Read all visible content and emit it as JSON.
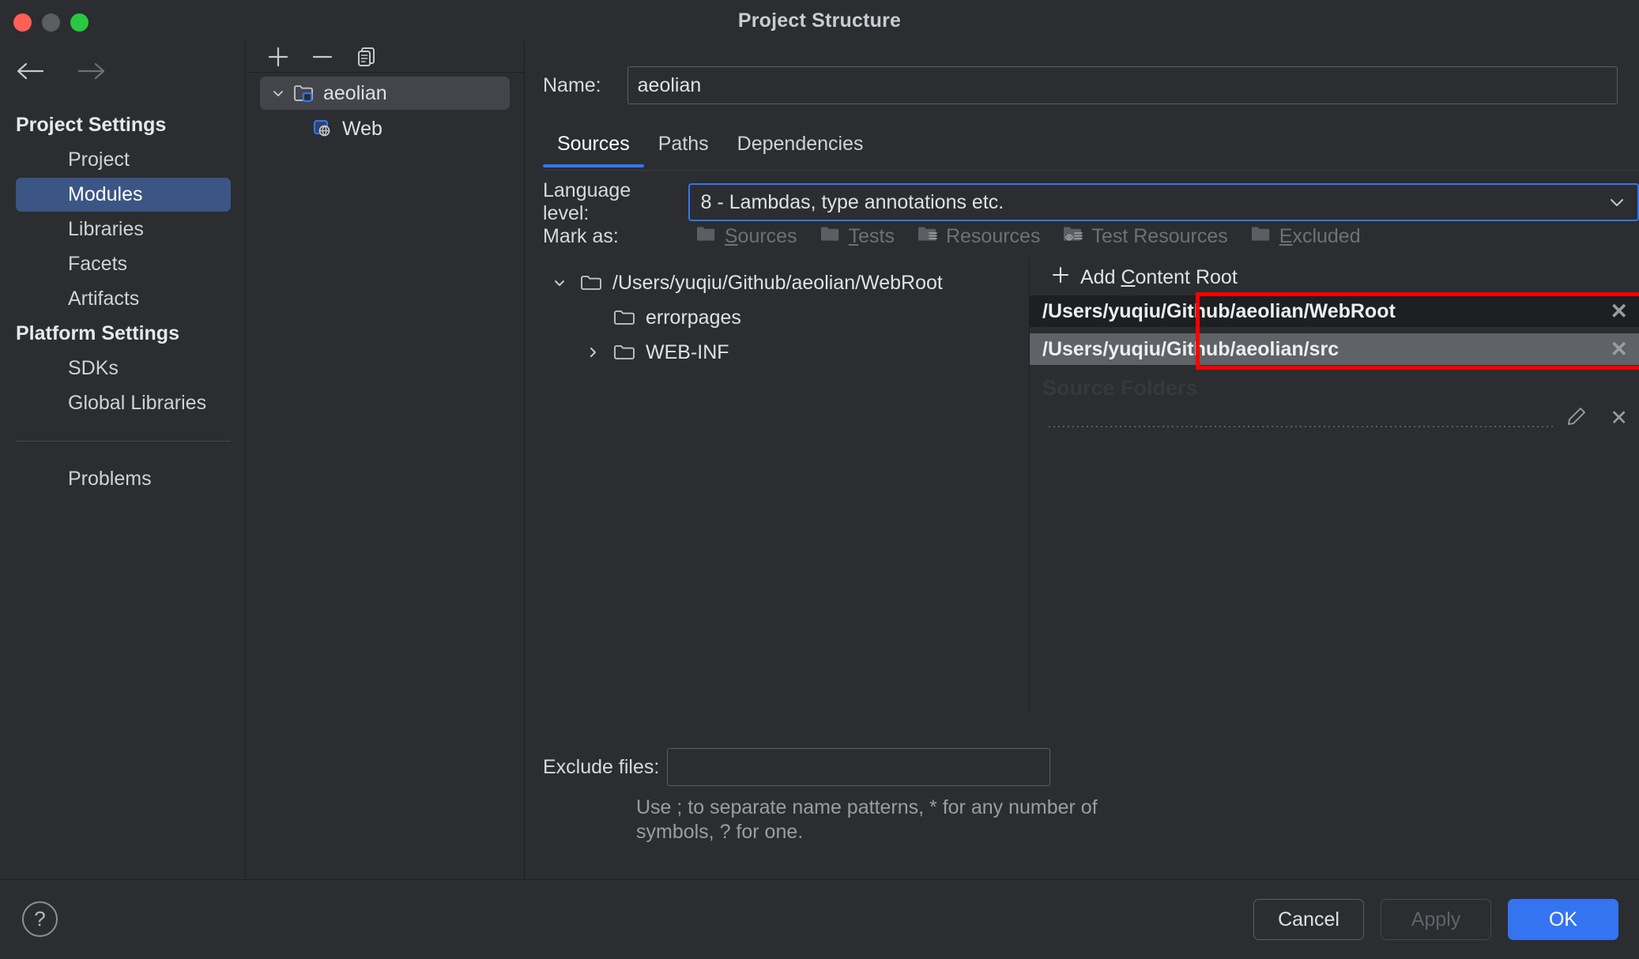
{
  "window": {
    "title": "Project Structure",
    "traffic_lights": [
      "close",
      "minimize",
      "zoom"
    ]
  },
  "sidebar": {
    "back_icon": "arrow-left-icon",
    "forward_icon": "arrow-right-icon",
    "groups": [
      {
        "title": "Project Settings",
        "items": [
          {
            "label": "Project",
            "selected": false
          },
          {
            "label": "Modules",
            "selected": true
          },
          {
            "label": "Libraries",
            "selected": false
          },
          {
            "label": "Facets",
            "selected": false
          },
          {
            "label": "Artifacts",
            "selected": false
          }
        ]
      },
      {
        "title": "Platform Settings",
        "items": [
          {
            "label": "SDKs",
            "selected": false
          },
          {
            "label": "Global Libraries",
            "selected": false
          }
        ]
      }
    ],
    "footer_item": {
      "label": "Problems"
    }
  },
  "modules_panel": {
    "toolbar": {
      "add_label": "+",
      "remove_label": "–",
      "copy_label": "copy"
    },
    "tree": [
      {
        "label": "aeolian",
        "icon": "module-folder-icon",
        "expanded": true,
        "selected": true,
        "depth": 0
      },
      {
        "label": "Web",
        "icon": "web-facet-icon",
        "expanded": null,
        "selected": false,
        "depth": 1
      }
    ]
  },
  "detail": {
    "name_label": "Name:",
    "name_value": "aeolian",
    "tabs": [
      {
        "label": "Sources",
        "active": true
      },
      {
        "label": "Paths",
        "active": false
      },
      {
        "label": "Dependencies",
        "active": false
      }
    ],
    "language_level": {
      "label": "Language level:",
      "value": "8 - Lambdas, type annotations etc.",
      "chevron": "chevron-down-icon"
    },
    "mark_as": {
      "label": "Mark as:",
      "items": [
        {
          "label": "Sources",
          "mnemonic": "S",
          "icon": "folder-sources-icon",
          "disabled": true
        },
        {
          "label": "Tests",
          "mnemonic": "T",
          "icon": "folder-tests-icon",
          "disabled": true
        },
        {
          "label": "Resources",
          "mnemonic": "",
          "icon": "folder-resources-icon",
          "disabled": true
        },
        {
          "label": "Test Resources",
          "mnemonic": "",
          "icon": "folder-test-resources-icon",
          "disabled": true
        },
        {
          "label": "Excluded",
          "mnemonic": "E",
          "icon": "folder-excluded-icon",
          "disabled": true
        }
      ]
    },
    "file_tree": [
      {
        "label": "/Users/yuqiu/Github/aeolian/WebRoot",
        "expanded": true,
        "depth": 0
      },
      {
        "label": "errorpages",
        "expanded": null,
        "depth": 1
      },
      {
        "label": "WEB-INF",
        "expanded": false,
        "depth": 1
      }
    ],
    "content_roots": {
      "add_label": "Add Content Root",
      "add_mnemonic": "C",
      "add_icon": "plus-icon",
      "rows": [
        {
          "path": "/Users/yuqiu/Github/aeolian/WebRoot",
          "state": "dark",
          "remove_icon": "close-icon"
        },
        {
          "path": "/Users/yuqiu/Github/aeolian/src",
          "state": "selected",
          "remove_icon": "close-icon"
        }
      ],
      "source_folders_label": "Source Folders",
      "edit_icon": "pencil-icon",
      "delete_icon": "close-icon"
    },
    "exclude": {
      "label": "Exclude files:",
      "value": "",
      "hint": "Use ; to separate name patterns, * for any number of symbols, ? for one."
    }
  },
  "annotation": {
    "type": "red-rectangle",
    "color": "#ff0000"
  },
  "footer": {
    "help_label": "?",
    "buttons": [
      {
        "label": "Cancel",
        "style": "secondary"
      },
      {
        "label": "Apply",
        "style": "disabled"
      },
      {
        "label": "OK",
        "style": "primary"
      }
    ]
  },
  "colors": {
    "background": "#2b2d30",
    "selection_blue": "#3b5585",
    "accent_blue": "#3574f0",
    "annotation_red": "#ff0000"
  }
}
